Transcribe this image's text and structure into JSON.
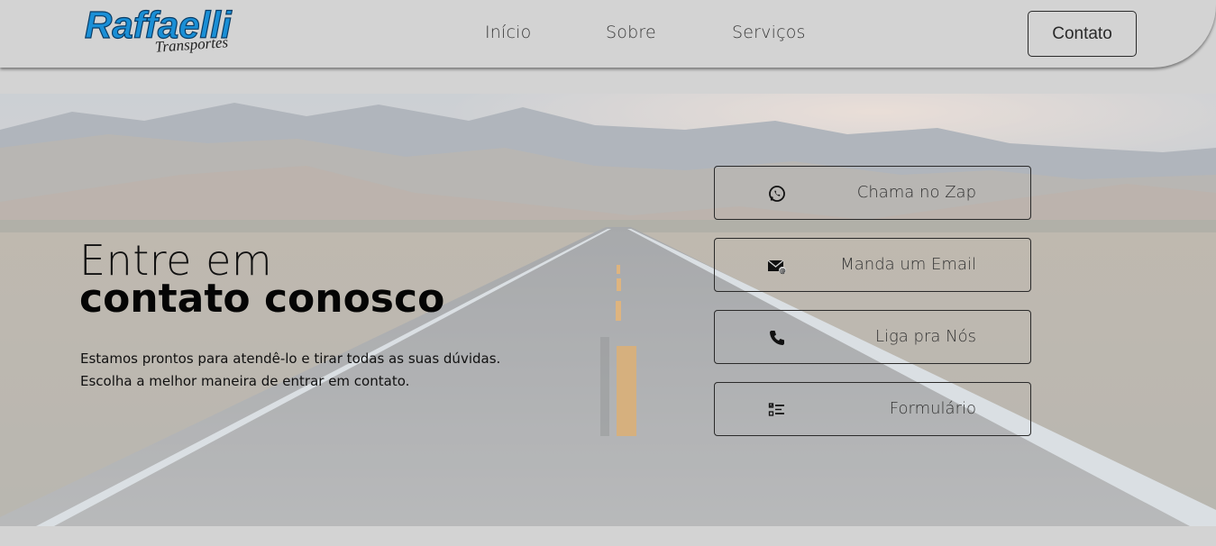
{
  "brand": {
    "name": "Raffaelli",
    "tagline": "Transportes",
    "color": "#1a8fd6"
  },
  "nav": {
    "links": [
      "Início",
      "Sobre",
      "Serviços"
    ],
    "contact_button": "Contato"
  },
  "hero": {
    "title_light": "Entre em",
    "title_bold": "contato conosco",
    "description_line1": "Estamos prontos para atendê-lo e tirar todas as suas dúvidas.",
    "description_line2": "Escolha a melhor maneira de entrar em contato."
  },
  "contact_options": [
    {
      "label": "Chama no Zap",
      "icon": "whatsapp-icon"
    },
    {
      "label": "Manda um Email",
      "icon": "email-icon"
    },
    {
      "label": "Liga pra Nós",
      "icon": "phone-icon"
    },
    {
      "label": "Formulário",
      "icon": "checklist-icon"
    }
  ]
}
